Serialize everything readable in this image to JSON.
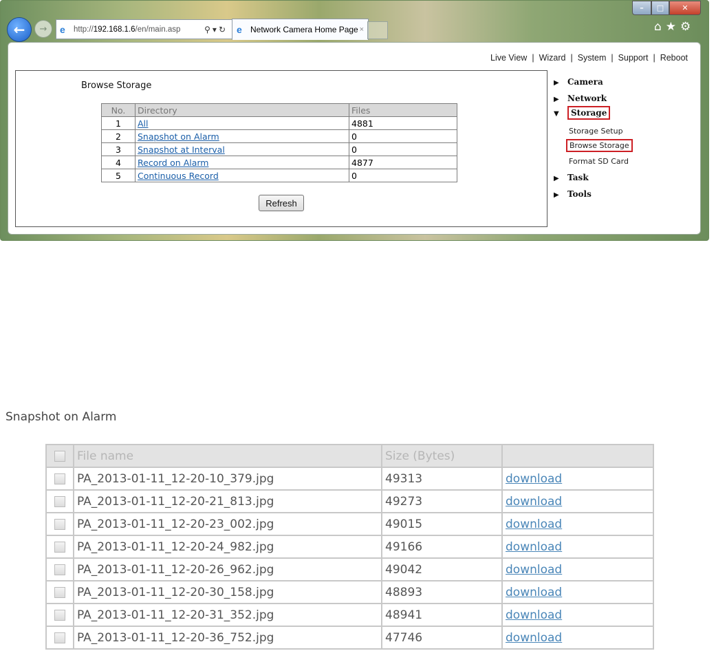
{
  "browser": {
    "url_prefix": "http://",
    "url_host": "192.168.1.6",
    "url_path": "/en/main.asp",
    "tab_title": "Network Camera Home Page",
    "tab_close": "×"
  },
  "topnav": [
    "Live View",
    "Wizard",
    "System",
    "Support",
    "Reboot"
  ],
  "browse_storage": {
    "title": "Browse Storage",
    "headers": {
      "no": "No.",
      "directory": "Directory",
      "files": "Files"
    },
    "rows": [
      {
        "no": "1",
        "directory": "All",
        "files": "4881"
      },
      {
        "no": "2",
        "directory": "Snapshot on Alarm",
        "files": "0"
      },
      {
        "no": "3",
        "directory": "Snapshot at Interval",
        "files": "0"
      },
      {
        "no": "4",
        "directory": "Record on Alarm",
        "files": "4877"
      },
      {
        "no": "5",
        "directory": "Continuous Record",
        "files": "0"
      }
    ],
    "refresh_label": "Refresh"
  },
  "sidemenu": {
    "camera": "Camera",
    "network": "Network",
    "storage": "Storage",
    "storage_setup": "Storage Setup",
    "browse_storage": "Browse Storage",
    "format_sd": "Format SD Card",
    "task": "Task",
    "tools": "Tools"
  },
  "snapshot_table": {
    "title": "Snapshot on Alarm",
    "headers": {
      "file_name": "File name",
      "size": "Size (Bytes)"
    },
    "download_label": "download",
    "rows": [
      {
        "file": "PA_2013-01-11_12-20-10_379.jpg",
        "size": "49313"
      },
      {
        "file": "PA_2013-01-11_12-20-21_813.jpg",
        "size": "49273"
      },
      {
        "file": "PA_2013-01-11_12-20-23_002.jpg",
        "size": "49015"
      },
      {
        "file": "PA_2013-01-11_12-20-24_982.jpg",
        "size": "49166"
      },
      {
        "file": "PA_2013-01-11_12-20-26_962.jpg",
        "size": "49042"
      },
      {
        "file": "PA_2013-01-11_12-20-30_158.jpg",
        "size": "48893"
      },
      {
        "file": "PA_2013-01-11_12-20-31_352.jpg",
        "size": "48941"
      },
      {
        "file": "PA_2013-01-11_12-20-36_752.jpg",
        "size": "47746"
      }
    ]
  },
  "icons": {
    "back": "back-arrow-icon",
    "forward": "forward-arrow-icon",
    "home": "home-icon",
    "favorites": "star-icon",
    "settings": "gear-icon"
  }
}
